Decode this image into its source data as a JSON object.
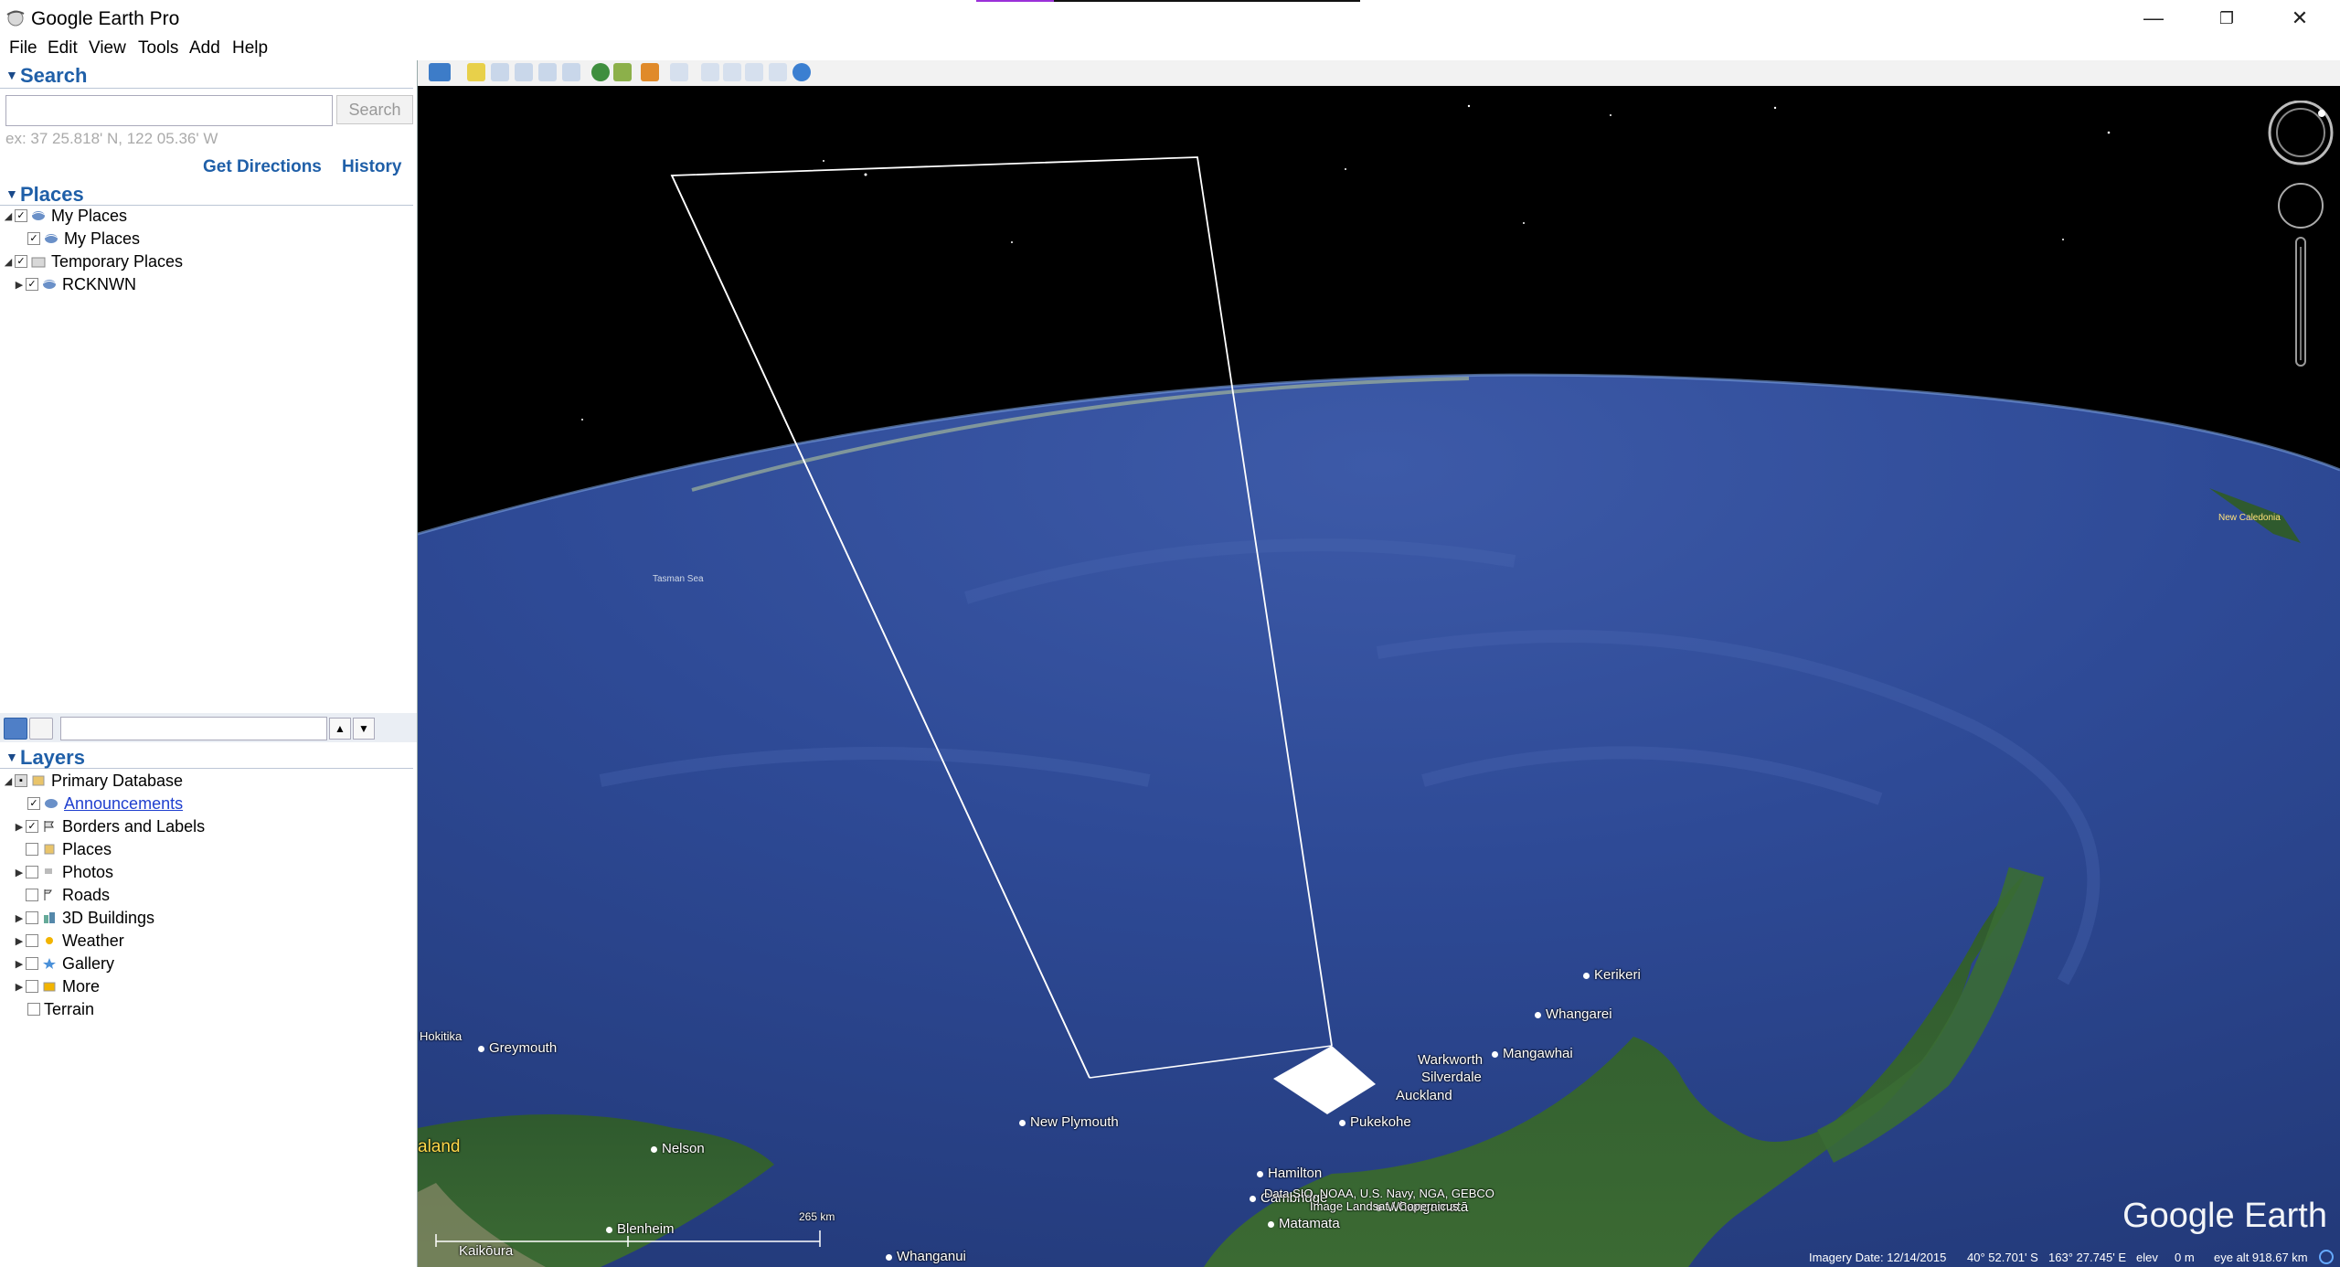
{
  "window": {
    "title": "Google Earth Pro",
    "minimize": "—",
    "restore": "❐",
    "close": "✕"
  },
  "menu": {
    "file": "File",
    "edit": "Edit",
    "view": "View",
    "tools": "Tools",
    "add": "Add",
    "help": "Help"
  },
  "search": {
    "header": "Search",
    "input_value": "",
    "button": "Search",
    "hint": "ex: 37 25.818' N, 122 05.36' W",
    "get_directions": "Get Directions",
    "history": "History"
  },
  "places": {
    "header": "Places",
    "items": [
      {
        "label": "My Places",
        "checked": true,
        "expanded": true
      },
      {
        "label": "My Places",
        "checked": true
      },
      {
        "label": "Temporary Places",
        "checked": true,
        "expanded": true
      },
      {
        "label": "RCKNWN",
        "checked": true
      }
    ]
  },
  "layers": {
    "header": "Layers",
    "filter_value": "",
    "items": [
      {
        "label": "Primary Database",
        "checked": "partial",
        "expanded": true
      },
      {
        "label": "Announcements",
        "checked": true,
        "link": true
      },
      {
        "label": "Borders and Labels",
        "checked": true
      },
      {
        "label": "Places",
        "checked": false
      },
      {
        "label": "Photos",
        "checked": false
      },
      {
        "label": "Roads",
        "checked": false
      },
      {
        "label": "3D Buildings",
        "checked": false
      },
      {
        "label": "Weather",
        "checked": false
      },
      {
        "label": "Gallery",
        "checked": false
      },
      {
        "label": "More",
        "checked": false
      },
      {
        "label": "Terrain",
        "checked": false
      }
    ]
  },
  "map": {
    "labels": {
      "tasman_sea": "Tasman Sea",
      "new_caledonia": "New Caledonia",
      "kerikeri": "Kerikeri",
      "whangarei": "Whangarei",
      "mangawhai": "Mangawhai",
      "warkworth": "Warkworth",
      "silverdale": "Silverdale",
      "auckland": "Auckland",
      "pukekohe": "Pukekohe",
      "new_plymouth": "New Plymouth",
      "hamilton": "Hamilton",
      "cambridge": "Cambridge",
      "whangamata": "Whangamatā",
      "matamata": "Matamata",
      "whanganui": "Whanganui",
      "hokitika": "Hokitika",
      "greymouth": "Greymouth",
      "nelson": "Nelson",
      "blenheim": "Blenheim",
      "kaikoura": "Kaikōura",
      "zealand": "aland"
    },
    "attribution1": "Data SIO, NOAA, U.S. Navy, NGA, GEBCO",
    "attribution2": "Image Landsat / Copernicus",
    "scale": "265 km",
    "logo": "Google Earth"
  },
  "status": {
    "imagery_date": "Imagery Date: 12/14/2015",
    "lat": "40° 52.701' S",
    "lon": "163° 27.745' E",
    "elev_label": "elev",
    "elev": "0 m",
    "eye_alt": "eye alt 918.67 km"
  }
}
